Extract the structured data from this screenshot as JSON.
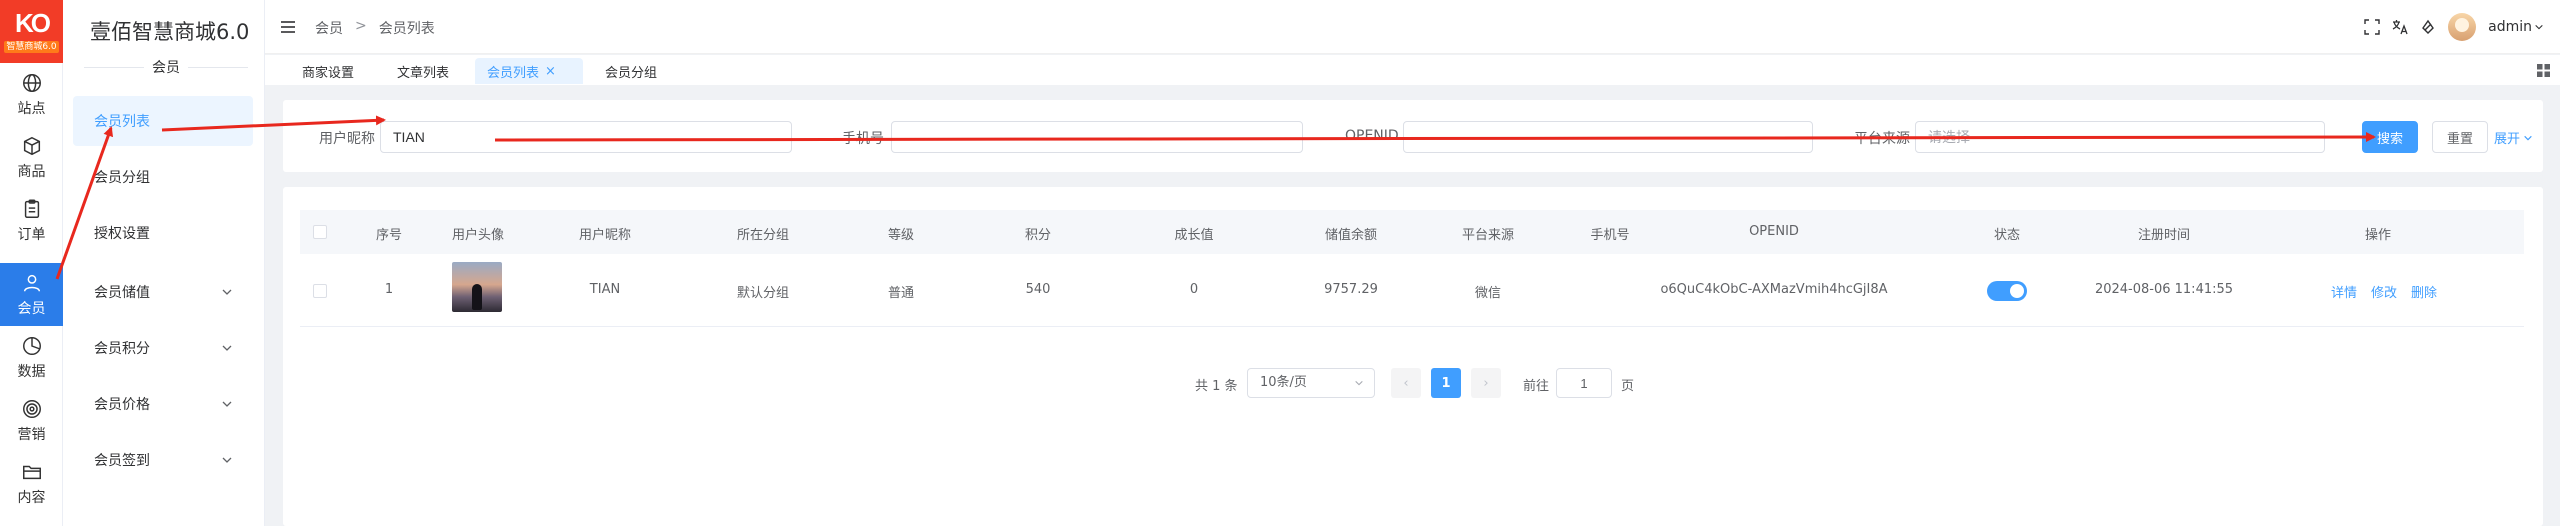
{
  "app": {
    "logo_badge": "智慧商城6.0",
    "brand": "壹佰智慧商城6.0"
  },
  "rail": [
    {
      "label": "站点",
      "icon": "globe-icon"
    },
    {
      "label": "商品",
      "icon": "box-icon"
    },
    {
      "label": "订单",
      "icon": "clipboard-icon"
    },
    {
      "label": "会员",
      "icon": "user-icon",
      "active": true
    },
    {
      "label": "数据",
      "icon": "pie-chart-icon"
    },
    {
      "label": "营销",
      "icon": "target-icon"
    },
    {
      "label": "内容",
      "icon": "folder-icon"
    }
  ],
  "menu": {
    "heading": "会员",
    "items": [
      {
        "label": "会员列表",
        "active": true
      },
      {
        "label": "会员分组"
      },
      {
        "label": "授权设置"
      },
      {
        "label": "会员储值",
        "expandable": true
      },
      {
        "label": "会员积分",
        "expandable": true
      },
      {
        "label": "会员价格",
        "expandable": true
      },
      {
        "label": "会员签到",
        "expandable": true
      }
    ]
  },
  "header": {
    "breadcrumb": [
      "会员",
      ">",
      "会员列表"
    ],
    "username": "admin"
  },
  "tabs": [
    {
      "label": "商家设置"
    },
    {
      "label": "文章列表"
    },
    {
      "label": "会员列表",
      "active": true,
      "close": "×"
    },
    {
      "label": "会员分组"
    }
  ],
  "filters": {
    "nickname_label": "用户昵称",
    "nickname_value": "TIAN",
    "phone_label": "手机号",
    "phone_value": "",
    "openid_label": "OPENID",
    "openid_value": "",
    "source_label": "平台来源",
    "source_placeholder": "请选择",
    "search": "搜索",
    "reset": "重置",
    "expand": "展开"
  },
  "table": {
    "headers": [
      "序号",
      "用户头像",
      "用户昵称",
      "所在分组",
      "等级",
      "积分",
      "成长值",
      "储值余额",
      "平台来源",
      "手机号",
      "OPENID",
      "状态",
      "注册时间",
      "操作"
    ],
    "rows": [
      {
        "index": "1",
        "nickname": "TIAN",
        "group": "默认分组",
        "level": "普通",
        "points": "540",
        "growth": "0",
        "balance": "9757.29",
        "source": "微信",
        "phone": "",
        "openid": "o6QuC4kObC-AXMazVmih4hcGjI8A",
        "status": true,
        "registered": "2024-08-06 11:41:55"
      }
    ],
    "actions": [
      "详情",
      "修改",
      "删除"
    ]
  },
  "pagination": {
    "total": "共 1 条",
    "page_size": "10条/页",
    "prev": "‹",
    "current": "1",
    "next": "›",
    "goto": "前往",
    "jump_value": "1",
    "page_unit": "页"
  },
  "colors": {
    "accent": "#409eff",
    "rail_active": "#2b7de9",
    "logo": "#f23c27",
    "annotation": "#e8281e"
  }
}
